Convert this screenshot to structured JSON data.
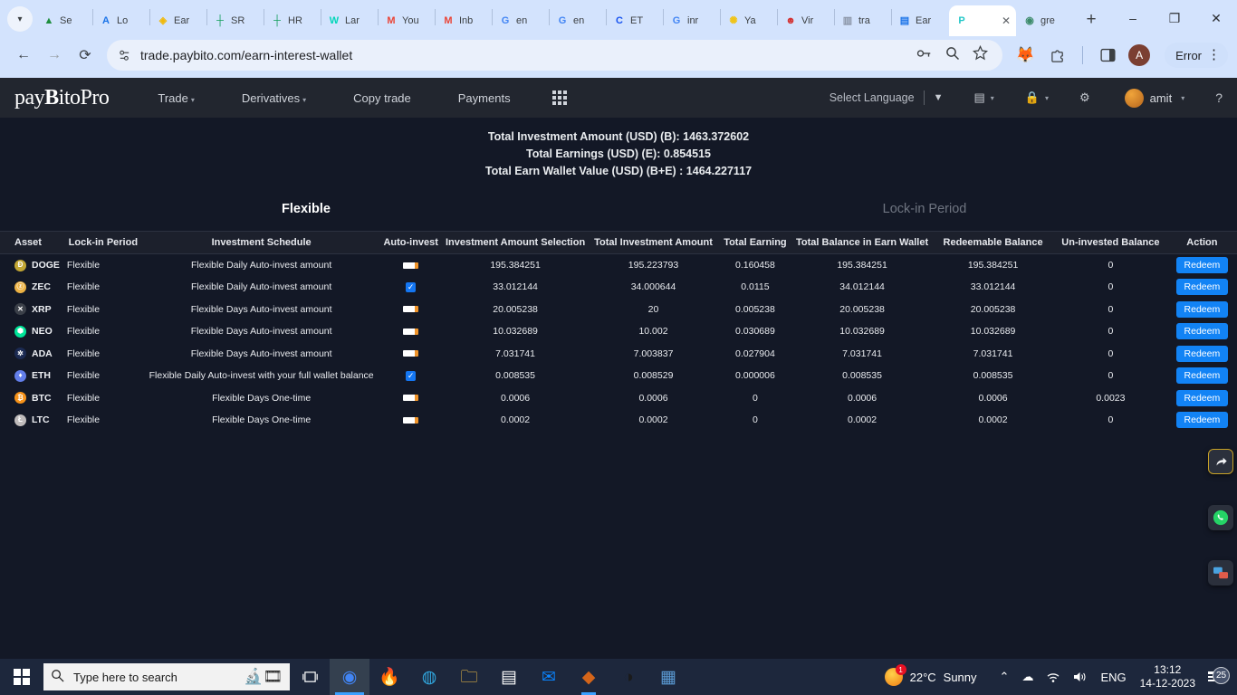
{
  "browser": {
    "tab_list_icon": "chevron-down-icon",
    "tabs": [
      {
        "label": "Se",
        "favicon": "drive-icon",
        "glyph": "▲",
        "color": "#1e8e3e",
        "active": false
      },
      {
        "label": "Lo",
        "favicon": "appsheet-icon",
        "glyph": "A",
        "color": "#1a73e8",
        "active": false
      },
      {
        "label": "Ear",
        "favicon": "binance-icon",
        "glyph": "◈",
        "color": "#f0b90b",
        "active": false
      },
      {
        "label": "SR",
        "favicon": "sheets-icon",
        "glyph": "┼",
        "color": "#0f9d58",
        "active": false
      },
      {
        "label": "HR",
        "favicon": "sheets-icon",
        "glyph": "┼",
        "color": "#0f9d58",
        "active": false
      },
      {
        "label": "Lar",
        "favicon": "lark-icon",
        "glyph": "W",
        "color": "#00d6b9",
        "active": false
      },
      {
        "label": "You",
        "favicon": "gmail-icon",
        "glyph": "M",
        "color": "#ea4335",
        "active": false
      },
      {
        "label": "Inb",
        "favicon": "gmail-icon",
        "glyph": "M",
        "color": "#ea4335",
        "active": false
      },
      {
        "label": "en",
        "favicon": "google-icon",
        "glyph": "G",
        "color": "#4285f4",
        "active": false
      },
      {
        "label": "en",
        "favicon": "google-icon",
        "glyph": "G",
        "color": "#4285f4",
        "active": false
      },
      {
        "label": "ET",
        "favicon": "coinbase-icon",
        "glyph": "C",
        "color": "#1652f0",
        "active": false
      },
      {
        "label": "inr",
        "favicon": "google-icon",
        "glyph": "G",
        "color": "#4285f4",
        "active": false
      },
      {
        "label": "Ya",
        "favicon": "yahoo-icon",
        "glyph": "✺",
        "color": "#f0c419",
        "active": false
      },
      {
        "label": "Vir",
        "favicon": "virus-icon",
        "glyph": "☻",
        "color": "#d32f2f",
        "active": false
      },
      {
        "label": "tra",
        "favicon": "chart-icon",
        "glyph": "▥",
        "color": "#8a94a6",
        "active": false
      },
      {
        "label": "Ear",
        "favicon": "docs-icon",
        "glyph": "▤",
        "color": "#1a73e8",
        "active": false
      },
      {
        "label": "",
        "favicon": "paybito-icon",
        "glyph": "P",
        "color": "#22c7c7",
        "active": true,
        "close_icon": "close-icon"
      },
      {
        "label": "gre",
        "favicon": "globe-icon",
        "glyph": "◉",
        "color": "#3d8b6b",
        "active": false
      }
    ],
    "new_tab_label": "+",
    "window_controls": {
      "minimize": "–",
      "maximize": "❐",
      "close": "✕"
    },
    "nav": {
      "back": "←",
      "forward": "→",
      "reload": "⟳"
    },
    "url": "trade.paybito.com/earn-interest-wallet",
    "site_info_icon": "site-settings-icon",
    "omnibox_icons": [
      "password-key-icon",
      "search-zoom-icon",
      "bookmark-star-icon"
    ],
    "extensions": [
      {
        "name": "metamask-icon",
        "glyph": "🦊"
      },
      {
        "name": "extensions-puzzle-icon",
        "glyph": "⊞"
      }
    ],
    "side_panel_icon": "side-panel-icon",
    "profile_initial": "A",
    "error_label": "Error",
    "menu_icon": "three-dot-menu-icon"
  },
  "app": {
    "brand_pre": "pay",
    "brand_b": "B",
    "brand_post": "itoPro",
    "nav_links": [
      {
        "label": "Trade",
        "has_caret": true
      },
      {
        "label": "Derivatives",
        "has_caret": true
      },
      {
        "label": "Copy trade",
        "has_caret": false
      },
      {
        "label": "Payments",
        "has_caret": false
      }
    ],
    "apps_grid_icon": "apps-grid-icon",
    "language_label": "Select Language",
    "language_caret_icon": "filter-caret-icon",
    "wallet_icon": "wallet-icon",
    "lock_icon": "security-lock-icon",
    "settings_icon": "gear-icon",
    "username": "amit",
    "help_icon": "help-circle-icon"
  },
  "summary": {
    "total_investment": "Total Investment Amount (USD) (B): 1463.372602",
    "total_earnings": "Total Earnings (USD) (E): 0.854515",
    "total_wallet_value": "Total Earn Wallet Value (USD) (B+E) : 1464.227117"
  },
  "tabs": {
    "flexible": "Flexible",
    "lockin": "Lock-in Period",
    "active": "Flexible"
  },
  "table": {
    "headers": [
      "Asset",
      "Lock-in Period",
      "Investment Schedule",
      "Auto-invest",
      "Investment Amount Selection",
      "Total Investment Amount",
      "Total Earning",
      "Total Balance in Earn Wallet",
      "Redeemable Balance",
      "Un-invested Balance",
      "Action"
    ],
    "action_label": "Redeem",
    "rows": [
      {
        "asset": "DOGE",
        "coin_glyph": "Ð",
        "coin_color": "#c2a633",
        "lockin": "Flexible",
        "schedule": "Flexible Daily Auto-invest amount",
        "auto_invest": false,
        "amount_selection": "195.384251",
        "total_investment": "195.223793",
        "total_earning": "0.160458",
        "total_balance": "195.384251",
        "redeemable": "195.384251",
        "uninvested": "0"
      },
      {
        "asset": "ZEC",
        "coin_glyph": "ⓩ",
        "coin_color": "#ecb244",
        "lockin": "Flexible",
        "schedule": "Flexible Daily Auto-invest amount",
        "auto_invest": true,
        "amount_selection": "33.012144",
        "total_investment": "34.000644",
        "total_earning": "0.0115",
        "total_balance": "34.012144",
        "redeemable": "33.012144",
        "uninvested": "0"
      },
      {
        "asset": "XRP",
        "coin_glyph": "✕",
        "coin_color": "#3b4049",
        "lockin": "Flexible",
        "schedule": "Flexible Days Auto-invest amount",
        "auto_invest": false,
        "amount_selection": "20.005238",
        "total_investment": "20",
        "total_earning": "0.005238",
        "total_balance": "20.005238",
        "redeemable": "20.005238",
        "uninvested": "0"
      },
      {
        "asset": "NEO",
        "coin_glyph": "⬢",
        "coin_color": "#00e599",
        "lockin": "Flexible",
        "schedule": "Flexible Days Auto-invest amount",
        "auto_invest": false,
        "amount_selection": "10.032689",
        "total_investment": "10.002",
        "total_earning": "0.030689",
        "total_balance": "10.032689",
        "redeemable": "10.032689",
        "uninvested": "0"
      },
      {
        "asset": "ADA",
        "coin_glyph": "✲",
        "coin_color": "#1b2a52",
        "lockin": "Flexible",
        "schedule": "Flexible Days Auto-invest amount",
        "auto_invest": false,
        "amount_selection": "7.031741",
        "total_investment": "7.003837",
        "total_earning": "0.027904",
        "total_balance": "7.031741",
        "redeemable": "7.031741",
        "uninvested": "0"
      },
      {
        "asset": "ETH",
        "coin_glyph": "♦",
        "coin_color": "#627eea",
        "lockin": "Flexible",
        "schedule": "Flexible Daily Auto-invest with your full wallet balance",
        "auto_invest": true,
        "amount_selection": "0.008535",
        "total_investment": "0.008529",
        "total_earning": "0.000006",
        "total_balance": "0.008535",
        "redeemable": "0.008535",
        "uninvested": "0"
      },
      {
        "asset": "BTC",
        "coin_glyph": "₿",
        "coin_color": "#f7931a",
        "lockin": "Flexible",
        "schedule": "Flexible Days One-time",
        "auto_invest": false,
        "amount_selection": "0.0006",
        "total_investment": "0.0006",
        "total_earning": "0",
        "total_balance": "0.0006",
        "redeemable": "0.0006",
        "uninvested": "0.0023"
      },
      {
        "asset": "LTC",
        "coin_glyph": "Ł",
        "coin_color": "#bfbbbb",
        "lockin": "Flexible",
        "schedule": "Flexible Days One-time",
        "auto_invest": false,
        "amount_selection": "0.0002",
        "total_investment": "0.0002",
        "total_earning": "0",
        "total_balance": "0.0002",
        "redeemable": "0.0002",
        "uninvested": "0"
      }
    ]
  },
  "floating_widgets": [
    {
      "name": "share-arrow-widget",
      "glyph": "↱"
    },
    {
      "name": "whatsapp-widget",
      "glyph": "✆"
    },
    {
      "name": "chat-support-widget",
      "glyph": "▰"
    }
  ],
  "taskbar": {
    "start_icon": "windows-start-icon",
    "search_placeholder": "Type here to search",
    "search_icon": "search-icon",
    "task_view_icon": "task-view-icon",
    "apps": [
      {
        "name": "chrome-icon",
        "glyph": "◉",
        "color": "#4285f4",
        "state": "active"
      },
      {
        "name": "firefox-icon",
        "glyph": "🔥",
        "color": "#ff7139",
        "state": "idle"
      },
      {
        "name": "edge-icon",
        "glyph": "◍",
        "color": "#31a8e0",
        "state": "idle"
      },
      {
        "name": "file-explorer-icon",
        "glyph": "🗀",
        "color": "#ffc848",
        "state": "idle"
      },
      {
        "name": "microsoft-store-icon",
        "glyph": "▤",
        "color": "#ffffff",
        "state": "idle"
      },
      {
        "name": "mail-icon",
        "glyph": "✉",
        "color": "#0a84ff",
        "state": "idle"
      },
      {
        "name": "paybito-app-icon",
        "glyph": "◆",
        "color": "#d4651a",
        "state": "running"
      },
      {
        "name": "opera-icon",
        "glyph": "◑",
        "color": "#1a1a1a",
        "state": "idle"
      },
      {
        "name": "calculator-icon",
        "glyph": "▦",
        "color": "#5b9bd5",
        "state": "idle"
      }
    ],
    "weather_temp": "22°C",
    "weather_cond": "Sunny",
    "weather_badge": "1",
    "tray_icons": [
      "chevron-up-icon",
      "cloud-icon",
      "wifi-icon",
      "volume-icon"
    ],
    "language": "ENG",
    "time": "13:12",
    "date": "14-12-2023",
    "notification_count": "25"
  }
}
